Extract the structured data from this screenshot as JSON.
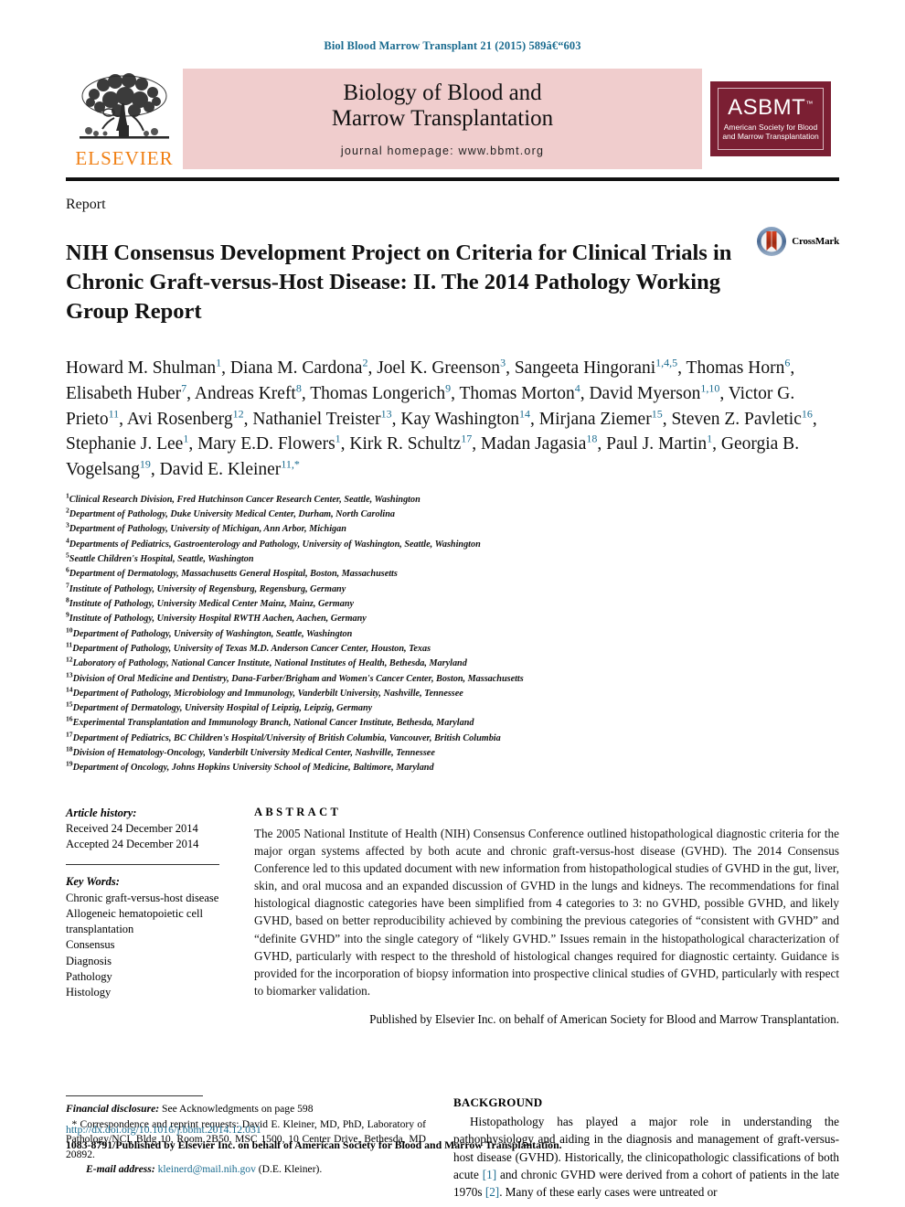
{
  "running_head": "Biol Blood Marrow Transplant 21 (2015) 589â€“603",
  "masthead": {
    "elsevier_wordmark": "ELSEVIER",
    "journal_title_line1": "Biology of Blood and",
    "journal_title_line2": "Marrow Transplantation",
    "journal_homepage": "journal homepage: www.bbmt.org",
    "society_acronym": "ASBMT",
    "society_tm": "™",
    "society_name_line1": "American Society for Blood",
    "society_name_line2": "and Marrow Transplantation",
    "banner_color": "#f0cdcd",
    "society_color": "#7b1f33",
    "elsevier_orange": "#F07F13",
    "accent_color": "#1a6b8f"
  },
  "article": {
    "type": "Report",
    "title": "NIH Consensus Development Project on Criteria for Clinical Trials in Chronic Graft-versus-Host Disease: II. The 2014 Pathology Working Group Report",
    "crossmark_label": "CrossMark"
  },
  "authors": [
    {
      "name": "Howard M. Shulman",
      "sup": "1",
      "sep": ", "
    },
    {
      "name": "Diana M. Cardona",
      "sup": "2",
      "sep": ", "
    },
    {
      "name": "Joel K. Greenson",
      "sup": "3",
      "sep": ", "
    },
    {
      "name": "Sangeeta Hingorani",
      "sup": "1,4,5",
      "sep": ", "
    },
    {
      "name": "Thomas Horn",
      "sup": "6",
      "sep": ", "
    },
    {
      "name": "Elisabeth Huber",
      "sup": "7",
      "sep": ", "
    },
    {
      "name": "Andreas Kreft",
      "sup": "8",
      "sep": ", "
    },
    {
      "name": "Thomas Longerich",
      "sup": "9",
      "sep": ", "
    },
    {
      "name": "Thomas Morton",
      "sup": "4",
      "sep": ", "
    },
    {
      "name": "David Myerson",
      "sup": "1,10",
      "sep": ", "
    },
    {
      "name": "Victor G. Prieto",
      "sup": "11",
      "sep": ", "
    },
    {
      "name": "Avi Rosenberg",
      "sup": "12",
      "sep": ", "
    },
    {
      "name": "Nathaniel Treister",
      "sup": "13",
      "sep": ", "
    },
    {
      "name": "Kay Washington",
      "sup": "14",
      "sep": ", "
    },
    {
      "name": "Mirjana Ziemer",
      "sup": "15",
      "sep": ", "
    },
    {
      "name": "Steven Z. Pavletic",
      "sup": "16",
      "sep": ", "
    },
    {
      "name": "Stephanie J. Lee",
      "sup": "1",
      "sep": ", "
    },
    {
      "name": "Mary E.D. Flowers",
      "sup": "1",
      "sep": ", "
    },
    {
      "name": "Kirk R. Schultz",
      "sup": "17",
      "sep": ", "
    },
    {
      "name": "Madan Jagasia",
      "sup": "18",
      "sep": ", "
    },
    {
      "name": "Paul J. Martin",
      "sup": "1",
      "sep": ", "
    },
    {
      "name": "Georgia B. Vogelsang",
      "sup": "19",
      "sep": ", "
    },
    {
      "name": "David E. Kleiner",
      "sup": "11,",
      "star": "*",
      "sep": ""
    }
  ],
  "affiliations": [
    {
      "num": "1",
      "text": "Clinical Research Division, Fred Hutchinson Cancer Research Center, Seattle, Washington"
    },
    {
      "num": "2",
      "text": "Department of Pathology, Duke University Medical Center, Durham, North Carolina"
    },
    {
      "num": "3",
      "text": "Department of Pathology, University of Michigan, Ann Arbor, Michigan"
    },
    {
      "num": "4",
      "text": "Departments of Pediatrics, Gastroenterology and Pathology, University of Washington, Seattle, Washington"
    },
    {
      "num": "5",
      "text": "Seattle Children's Hospital, Seattle, Washington"
    },
    {
      "num": "6",
      "text": "Department of Dermatology, Massachusetts General Hospital, Boston, Massachusetts"
    },
    {
      "num": "7",
      "text": "Institute of Pathology, University of Regensburg, Regensburg, Germany"
    },
    {
      "num": "8",
      "text": "Institute of Pathology, University Medical Center Mainz, Mainz, Germany"
    },
    {
      "num": "9",
      "text": "Institute of Pathology, University Hospital RWTH Aachen, Aachen, Germany"
    },
    {
      "num": "10",
      "text": "Department of Pathology, University of Washington, Seattle, Washington"
    },
    {
      "num": "11",
      "text": "Department of Pathology, University of Texas M.D. Anderson Cancer Center, Houston, Texas"
    },
    {
      "num": "12",
      "text": "Laboratory of Pathology, National Cancer Institute, National Institutes of Health, Bethesda, Maryland"
    },
    {
      "num": "13",
      "text": "Division of Oral Medicine and Dentistry, Dana-Farber/Brigham and Women's Cancer Center, Boston, Massachusetts"
    },
    {
      "num": "14",
      "text": "Department of Pathology, Microbiology and Immunology, Vanderbilt University, Nashville, Tennessee"
    },
    {
      "num": "15",
      "text": "Department of Dermatology, University Hospital of Leipzig, Leipzig, Germany"
    },
    {
      "num": "16",
      "text": "Experimental Transplantation and Immunology Branch, National Cancer Institute, Bethesda, Maryland"
    },
    {
      "num": "17",
      "text": "Department of Pediatrics, BC Children's Hospital/University of British Columbia, Vancouver, British Columbia"
    },
    {
      "num": "18",
      "text": "Division of Hematology-Oncology, Vanderbilt University Medical Center, Nashville, Tennessee"
    },
    {
      "num": "19",
      "text": "Department of Oncology, Johns Hopkins University School of Medicine, Baltimore, Maryland"
    }
  ],
  "article_info": {
    "history_head": "Article history:",
    "received": "Received 24 December 2014",
    "accepted": "Accepted 24 December 2014",
    "keywords_head": "Key Words:",
    "keywords": [
      "Chronic graft-versus-host disease",
      "Allogeneic hematopoietic cell transplantation",
      "Consensus",
      "Diagnosis",
      "Pathology",
      "Histology"
    ]
  },
  "abstract": {
    "heading": "ABSTRACT",
    "body": "The 2005 National Institute of Health (NIH) Consensus Conference outlined histopathological diagnostic criteria for the major organ systems affected by both acute and chronic graft-versus-host disease (GVHD). The 2014 Consensus Conference led to this updated document with new information from histopathological studies of GVHD in the gut, liver, skin, and oral mucosa and an expanded discussion of GVHD in the lungs and kidneys. The recommendations for final histological diagnostic categories have been simplified from 4 categories to 3: no GVHD, possible GVHD, and likely GVHD, based on better reproducibility achieved by combining the previous categories of “consistent with GVHD” and “definite GVHD” into the single category of “likely GVHD.” Issues remain in the histopathological characterization of GVHD, particularly with respect to the threshold of histological changes required for diagnostic certainty. Guidance is provided for the incorporation of biopsy information into prospective clinical studies of GVHD, particularly with respect to biomarker validation.",
    "publisher_line": "Published by Elsevier Inc. on behalf of American Society for Blood and Marrow Transplantation."
  },
  "footnotes": {
    "financial_disclosure_label": "Financial disclosure:",
    "financial_disclosure_text": " See Acknowledgments on page 598",
    "correspondence_star": "*",
    "correspondence_text": " Correspondence and reprint requests: David E. Kleiner, MD, PhD, Laboratory of Pathology/NCI, Bldg 10, Room 2B50, MSC 1500, 10 Center Drive, Bethesda, MD 20892.",
    "email_label": "E-mail address:",
    "email_address": "kleinerd@mail.nih.gov",
    "email_attribution": " (D.E. Kleiner)."
  },
  "background": {
    "heading": "BACKGROUND",
    "p1_a": "Histopathology has played a major role in understanding the pathophysiology and aiding in the diagnosis and management of graft-versus-host disease (GVHD). Historically, the clinicopathologic classifications of both acute ",
    "ref1": "[1]",
    "p1_b": " and chronic GVHD were derived from a cohort of patients in the late 1970s ",
    "ref2": "[2]",
    "p1_c": ". Many of these early cases were untreated or"
  },
  "footer": {
    "doi": "http://dx.doi.org/10.1016/j.bbmt.2014.12.031",
    "issn_line": "1083-8791/Published by Elsevier Inc. on behalf of American Society for Blood and Marrow Transplantation."
  }
}
